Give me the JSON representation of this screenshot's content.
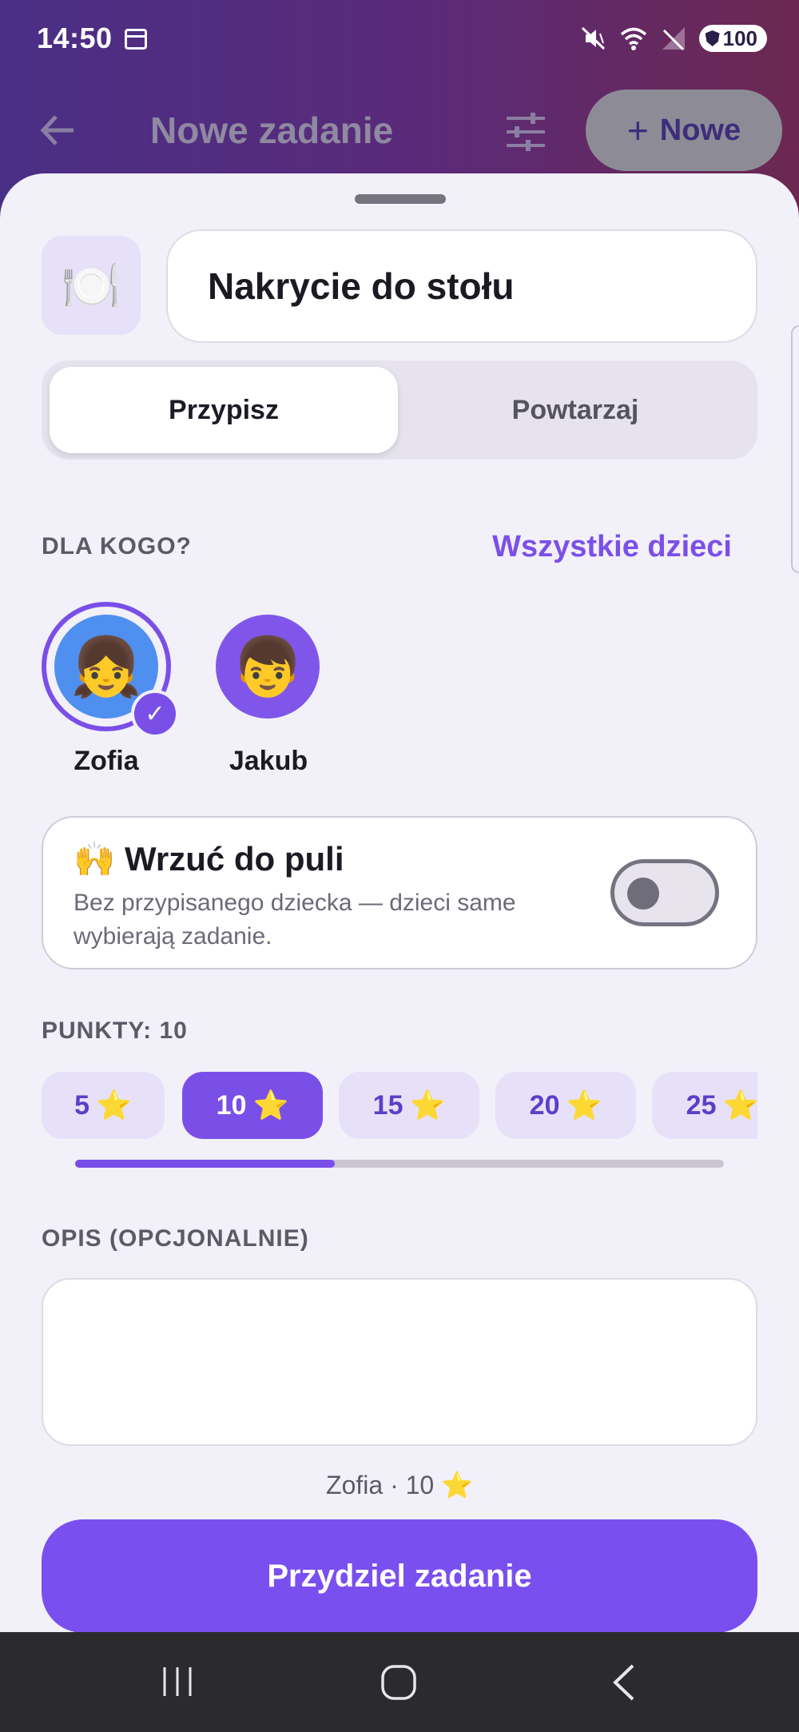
{
  "status_bar": {
    "time": "14:50",
    "battery": "100",
    "icons": [
      "calendar-icon",
      "mute-vibrate-icon",
      "wifi-icon",
      "no-signal-icon",
      "battery-shield-icon"
    ]
  },
  "header": {
    "title": "Nowe zadanie",
    "new_button_label": "Nowe",
    "colors": {
      "gradient_start": "#4a2f86",
      "gradient_end": "#6c2850"
    }
  },
  "task": {
    "icon": "🍽️",
    "title": "Nakrycie do stołu"
  },
  "mode_tabs": [
    {
      "label": "Przypisz",
      "selected": true
    },
    {
      "label": "Powtarzaj",
      "selected": false
    }
  ],
  "assign": {
    "section_label": "DLA KOGO?",
    "all_kids_link": "Wszystkie dzieci",
    "children": [
      {
        "name": "Zofia",
        "emoji": "👧",
        "selected": true,
        "color": "#4f8ff0"
      },
      {
        "name": "Jakub",
        "emoji": "👦",
        "selected": false,
        "color": "#8056ea"
      }
    ]
  },
  "pool": {
    "emoji": "🙌",
    "title": "Wrzuć do puli",
    "description": "Bez przypisanego dziecka — dzieci same wybierają zadanie.",
    "enabled": false
  },
  "points": {
    "label": "PUNKTY: 10",
    "options": [
      "5",
      "10",
      "15",
      "20",
      "25"
    ],
    "star": "⭐",
    "selected": "10",
    "scroll_position": 0.4
  },
  "description_field": {
    "label": "OPIS (OPCJONALNIE)",
    "value": ""
  },
  "summary": {
    "text": "Zofia · 10",
    "star": "⭐"
  },
  "submit_label": "Przydziel zadanie",
  "accent_color": "#7a4fe8"
}
